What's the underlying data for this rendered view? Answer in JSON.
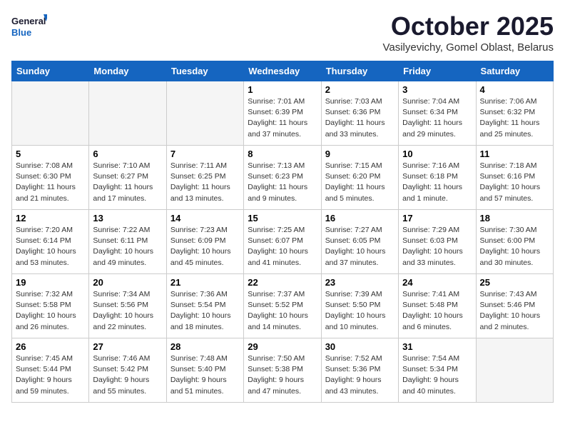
{
  "logo": {
    "line1": "General",
    "line2": "Blue"
  },
  "title": "October 2025",
  "subtitle": "Vasilyevichy, Gomel Oblast, Belarus",
  "weekdays": [
    "Sunday",
    "Monday",
    "Tuesday",
    "Wednesday",
    "Thursday",
    "Friday",
    "Saturday"
  ],
  "weeks": [
    [
      {
        "day": "",
        "info": ""
      },
      {
        "day": "",
        "info": ""
      },
      {
        "day": "",
        "info": ""
      },
      {
        "day": "1",
        "info": "Sunrise: 7:01 AM\nSunset: 6:39 PM\nDaylight: 11 hours\nand 37 minutes."
      },
      {
        "day": "2",
        "info": "Sunrise: 7:03 AM\nSunset: 6:36 PM\nDaylight: 11 hours\nand 33 minutes."
      },
      {
        "day": "3",
        "info": "Sunrise: 7:04 AM\nSunset: 6:34 PM\nDaylight: 11 hours\nand 29 minutes."
      },
      {
        "day": "4",
        "info": "Sunrise: 7:06 AM\nSunset: 6:32 PM\nDaylight: 11 hours\nand 25 minutes."
      }
    ],
    [
      {
        "day": "5",
        "info": "Sunrise: 7:08 AM\nSunset: 6:30 PM\nDaylight: 11 hours\nand 21 minutes."
      },
      {
        "day": "6",
        "info": "Sunrise: 7:10 AM\nSunset: 6:27 PM\nDaylight: 11 hours\nand 17 minutes."
      },
      {
        "day": "7",
        "info": "Sunrise: 7:11 AM\nSunset: 6:25 PM\nDaylight: 11 hours\nand 13 minutes."
      },
      {
        "day": "8",
        "info": "Sunrise: 7:13 AM\nSunset: 6:23 PM\nDaylight: 11 hours\nand 9 minutes."
      },
      {
        "day": "9",
        "info": "Sunrise: 7:15 AM\nSunset: 6:20 PM\nDaylight: 11 hours\nand 5 minutes."
      },
      {
        "day": "10",
        "info": "Sunrise: 7:16 AM\nSunset: 6:18 PM\nDaylight: 11 hours\nand 1 minute."
      },
      {
        "day": "11",
        "info": "Sunrise: 7:18 AM\nSunset: 6:16 PM\nDaylight: 10 hours\nand 57 minutes."
      }
    ],
    [
      {
        "day": "12",
        "info": "Sunrise: 7:20 AM\nSunset: 6:14 PM\nDaylight: 10 hours\nand 53 minutes."
      },
      {
        "day": "13",
        "info": "Sunrise: 7:22 AM\nSunset: 6:11 PM\nDaylight: 10 hours\nand 49 minutes."
      },
      {
        "day": "14",
        "info": "Sunrise: 7:23 AM\nSunset: 6:09 PM\nDaylight: 10 hours\nand 45 minutes."
      },
      {
        "day": "15",
        "info": "Sunrise: 7:25 AM\nSunset: 6:07 PM\nDaylight: 10 hours\nand 41 minutes."
      },
      {
        "day": "16",
        "info": "Sunrise: 7:27 AM\nSunset: 6:05 PM\nDaylight: 10 hours\nand 37 minutes."
      },
      {
        "day": "17",
        "info": "Sunrise: 7:29 AM\nSunset: 6:03 PM\nDaylight: 10 hours\nand 33 minutes."
      },
      {
        "day": "18",
        "info": "Sunrise: 7:30 AM\nSunset: 6:00 PM\nDaylight: 10 hours\nand 30 minutes."
      }
    ],
    [
      {
        "day": "19",
        "info": "Sunrise: 7:32 AM\nSunset: 5:58 PM\nDaylight: 10 hours\nand 26 minutes."
      },
      {
        "day": "20",
        "info": "Sunrise: 7:34 AM\nSunset: 5:56 PM\nDaylight: 10 hours\nand 22 minutes."
      },
      {
        "day": "21",
        "info": "Sunrise: 7:36 AM\nSunset: 5:54 PM\nDaylight: 10 hours\nand 18 minutes."
      },
      {
        "day": "22",
        "info": "Sunrise: 7:37 AM\nSunset: 5:52 PM\nDaylight: 10 hours\nand 14 minutes."
      },
      {
        "day": "23",
        "info": "Sunrise: 7:39 AM\nSunset: 5:50 PM\nDaylight: 10 hours\nand 10 minutes."
      },
      {
        "day": "24",
        "info": "Sunrise: 7:41 AM\nSunset: 5:48 PM\nDaylight: 10 hours\nand 6 minutes."
      },
      {
        "day": "25",
        "info": "Sunrise: 7:43 AM\nSunset: 5:46 PM\nDaylight: 10 hours\nand 2 minutes."
      }
    ],
    [
      {
        "day": "26",
        "info": "Sunrise: 7:45 AM\nSunset: 5:44 PM\nDaylight: 9 hours\nand 59 minutes."
      },
      {
        "day": "27",
        "info": "Sunrise: 7:46 AM\nSunset: 5:42 PM\nDaylight: 9 hours\nand 55 minutes."
      },
      {
        "day": "28",
        "info": "Sunrise: 7:48 AM\nSunset: 5:40 PM\nDaylight: 9 hours\nand 51 minutes."
      },
      {
        "day": "29",
        "info": "Sunrise: 7:50 AM\nSunset: 5:38 PM\nDaylight: 9 hours\nand 47 minutes."
      },
      {
        "day": "30",
        "info": "Sunrise: 7:52 AM\nSunset: 5:36 PM\nDaylight: 9 hours\nand 43 minutes."
      },
      {
        "day": "31",
        "info": "Sunrise: 7:54 AM\nSunset: 5:34 PM\nDaylight: 9 hours\nand 40 minutes."
      },
      {
        "day": "",
        "info": ""
      }
    ]
  ]
}
